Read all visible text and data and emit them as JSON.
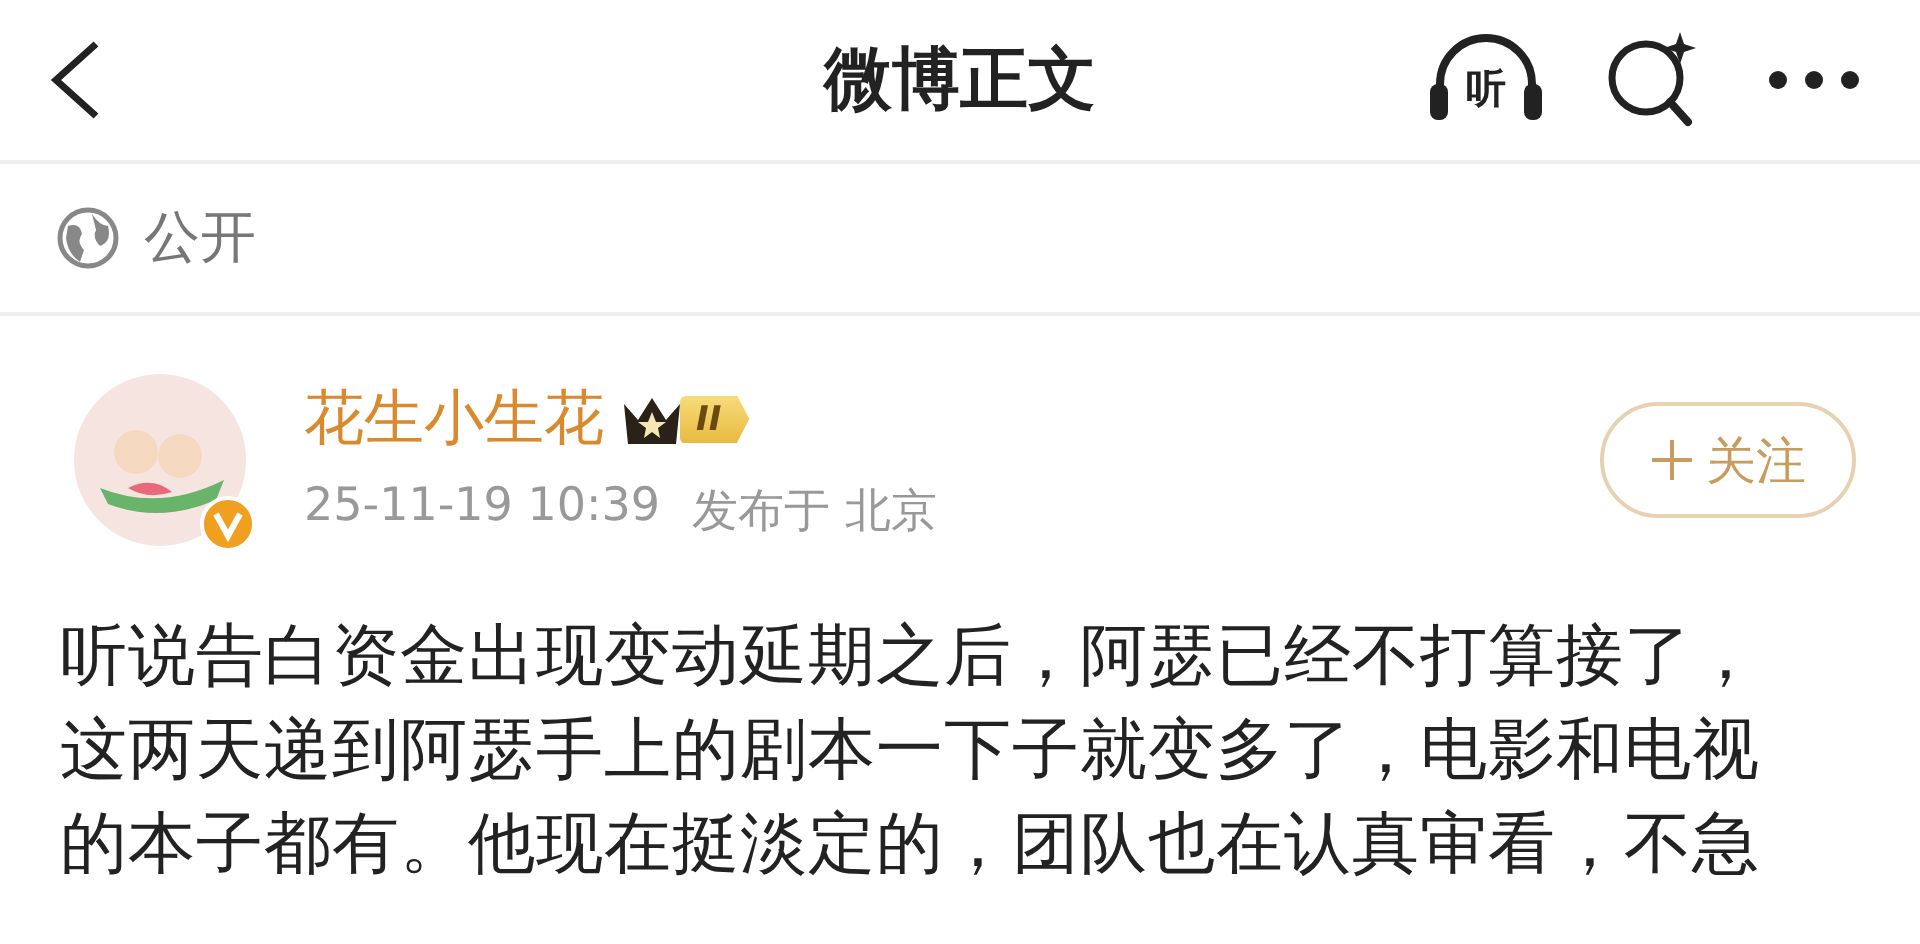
{
  "header": {
    "title": "微博正文",
    "listen_label": "听"
  },
  "visibility": {
    "label": "公开"
  },
  "post": {
    "author": "花生小生花",
    "verified": true,
    "level_badge": "II",
    "time": "25-11-19 10:39",
    "location": "发布于 北京",
    "follow_label": "关注",
    "followed": false,
    "text": "听说告白资金出现变动延期之后，阿瑟已经不打算接了，这两天递到阿瑟手上的剧本一下子就变多了，电影和电视的本子都有。他现在挺淡定的，团队也在认真审看，不急"
  }
}
